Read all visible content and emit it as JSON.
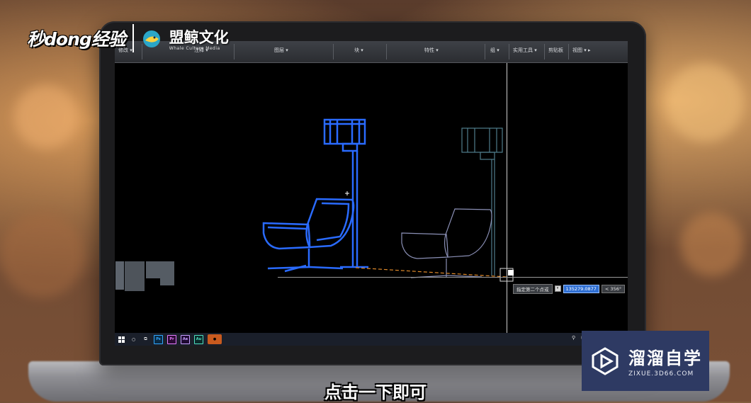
{
  "overlay": {
    "site_logo": "秒dong经验",
    "company_name": "盟鲸文化",
    "company_subtitle": "Whale Culture Media",
    "brand_title": "溜溜自学",
    "brand_url": "ZIXUE.3D66.COM",
    "subtitle": "点击一下即可"
  },
  "ribbon": {
    "panels": [
      {
        "label": "修改 ▾"
      },
      {
        "label": "注释 ▾"
      },
      {
        "label": "图层 ▾"
      },
      {
        "label": "块 ▾"
      },
      {
        "label": "特性 ▾"
      },
      {
        "label": "组 ▾"
      },
      {
        "label": "实用工具 ▾"
      },
      {
        "label": "剪贴板"
      },
      {
        "label": "视图 ▾ ▸"
      }
    ]
  },
  "command": {
    "prompt": "指定第二个点或",
    "value": "135279.0877",
    "angle": "< 356°"
  },
  "taskbar": {
    "apps": [
      "Ps",
      "Pr",
      "Ae",
      "Au"
    ]
  },
  "colors": {
    "drawing_blue": "#2a6bff",
    "ghost_cyan": "#2fa4c8",
    "brand_bg": "#2e3a63"
  }
}
